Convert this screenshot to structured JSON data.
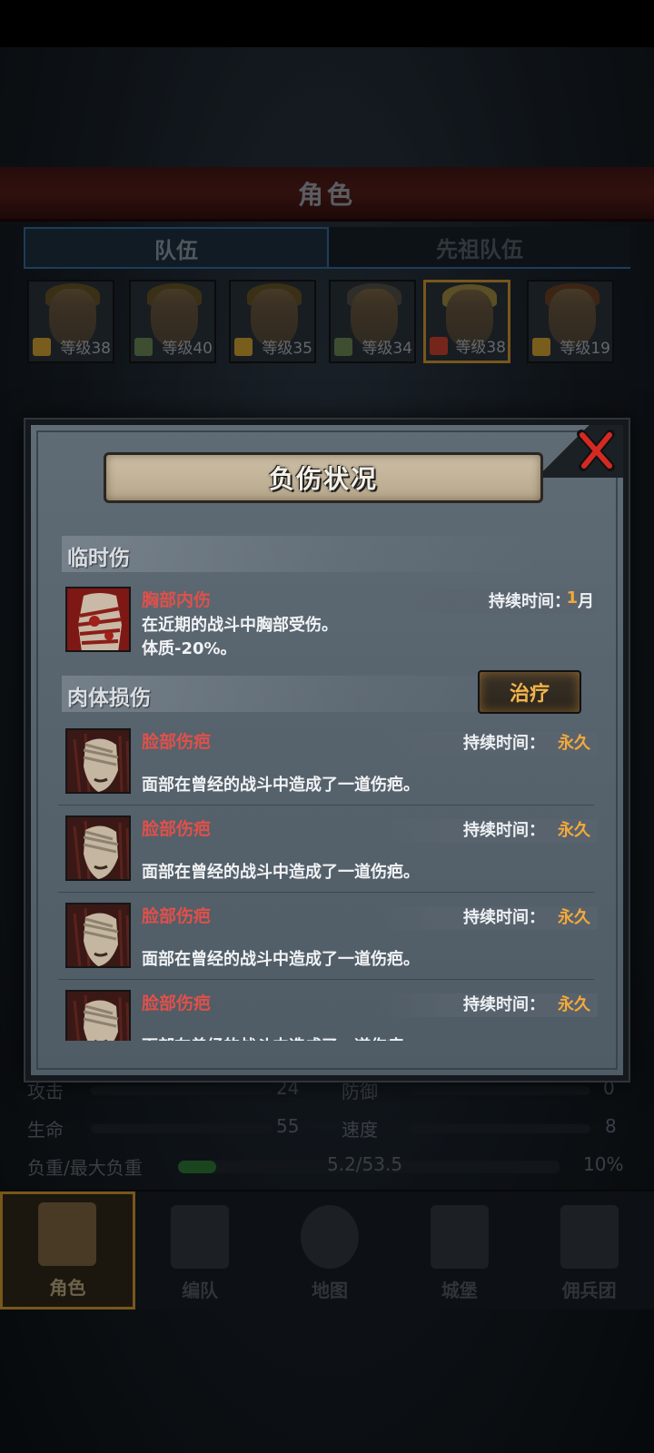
{
  "screen": {
    "title": "角色",
    "tabs": [
      {
        "label": "队伍",
        "active": true
      },
      {
        "label": "先祖队伍",
        "active": false
      }
    ],
    "heroes": [
      {
        "level": "等级38",
        "selected": false
      },
      {
        "level": "等级40",
        "selected": false
      },
      {
        "level": "等级35",
        "selected": false
      },
      {
        "level": "等级34",
        "selected": false
      },
      {
        "level": "等级38",
        "selected": true
      },
      {
        "level": "等级19",
        "selected": false
      }
    ],
    "stats": {
      "attack_label": "攻击",
      "attack_value": "24",
      "defense_label": "防御",
      "defense_value": "0",
      "hp_label": "生命",
      "hp_value": "55",
      "speed_label": "速度",
      "speed_value": "8",
      "load_label": "负重/最大负重",
      "load_value": "5.2/53.5",
      "load_percent": "10%",
      "load_fraction": 0.1
    },
    "nav": [
      {
        "label": "角色",
        "icon": "knight-icon",
        "active": true
      },
      {
        "label": "编队",
        "icon": "helmet-icon",
        "active": false
      },
      {
        "label": "地图",
        "icon": "compass-icon",
        "active": false
      },
      {
        "label": "城堡",
        "icon": "castle-icon",
        "active": false
      },
      {
        "label": "佣兵团",
        "icon": "mercenary-icon",
        "active": false
      }
    ]
  },
  "modal": {
    "title": "负伤状况",
    "close_icon": "close-x-icon",
    "temporary_section": "临时伤",
    "physical_section": "肉体损伤",
    "heal_button": "治疗",
    "temporary_injuries": [
      {
        "name": "胸部内伤",
        "duration_label": "持续时间：",
        "duration_value": "1",
        "duration_unit": "月",
        "desc": "在近期的战斗中胸部受伤。",
        "effect": "体质-20%。",
        "icon": "bandaged-chest-icon"
      }
    ],
    "physical_injuries": [
      {
        "name": "脸部伤疤",
        "duration_label": "持续时间：",
        "duration_value": "永久",
        "desc": "面部在曾经的战斗中造成了一道伤疤。",
        "icon": "bandaged-face-icon"
      },
      {
        "name": "脸部伤疤",
        "duration_label": "持续时间：",
        "duration_value": "永久",
        "desc": "面部在曾经的战斗中造成了一道伤疤。",
        "icon": "bandaged-face-icon"
      },
      {
        "name": "脸部伤疤",
        "duration_label": "持续时间：",
        "duration_value": "永久",
        "desc": "面部在曾经的战斗中造成了一道伤疤。",
        "icon": "bandaged-face-icon"
      },
      {
        "name": "脸部伤疤",
        "duration_label": "持续时间：",
        "duration_value": "永久",
        "desc": "面部在曾经的战斗中造成了一道伤疤。",
        "icon": "bandaged-face-icon"
      }
    ]
  }
}
